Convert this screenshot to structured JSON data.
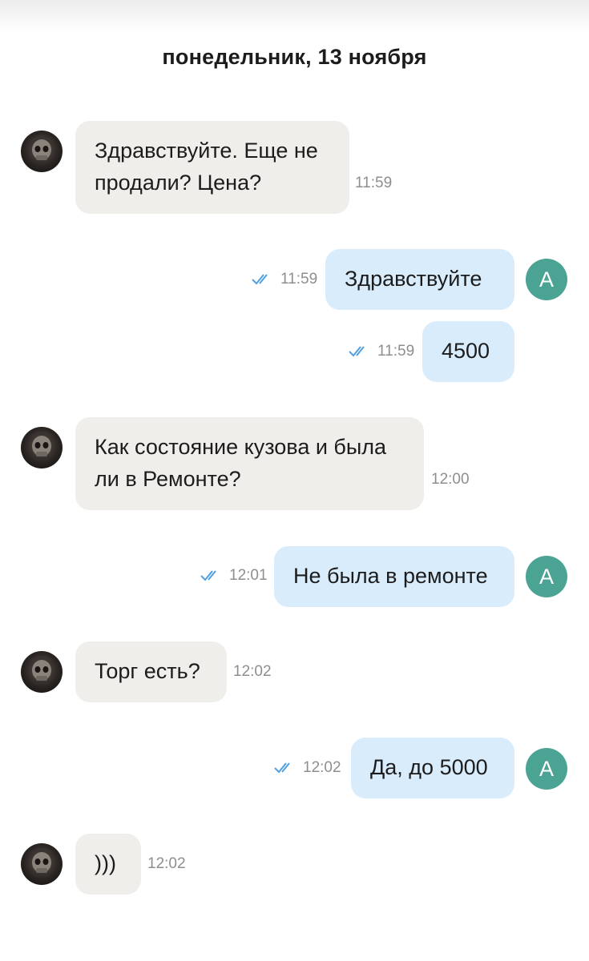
{
  "date_header": "понедельник, 13 ноября",
  "outgoing_avatar_letter": "А",
  "colors": {
    "incoming_bubble": "#f0eeea",
    "outgoing_bubble": "#d9ecfb",
    "avatar": "#4aa393",
    "read_check": "#4f9fe0"
  },
  "messages": [
    {
      "direction": "in",
      "lines": [
        "Здравствуйте. Еще не",
        "продали? Цена?"
      ],
      "time": "11:59"
    },
    {
      "direction": "out",
      "lines": [
        "Здравствуйте"
      ],
      "time": "11:59",
      "status": "read"
    },
    {
      "direction": "out",
      "lines": [
        "4500"
      ],
      "time": "11:59",
      "status": "read"
    },
    {
      "direction": "in",
      "lines": [
        "Как состояние кузова и была",
        "ли в Ремонте?"
      ],
      "time": "12:00"
    },
    {
      "direction": "out",
      "lines": [
        "Не была в ремонте"
      ],
      "time": "12:01",
      "status": "read"
    },
    {
      "direction": "in",
      "lines": [
        "Торг есть?"
      ],
      "time": "12:02"
    },
    {
      "direction": "out",
      "lines": [
        "Да, до 5000"
      ],
      "time": "12:02",
      "status": "read"
    },
    {
      "direction": "in",
      "lines": [
        ")))"
      ],
      "time": "12:02"
    }
  ]
}
